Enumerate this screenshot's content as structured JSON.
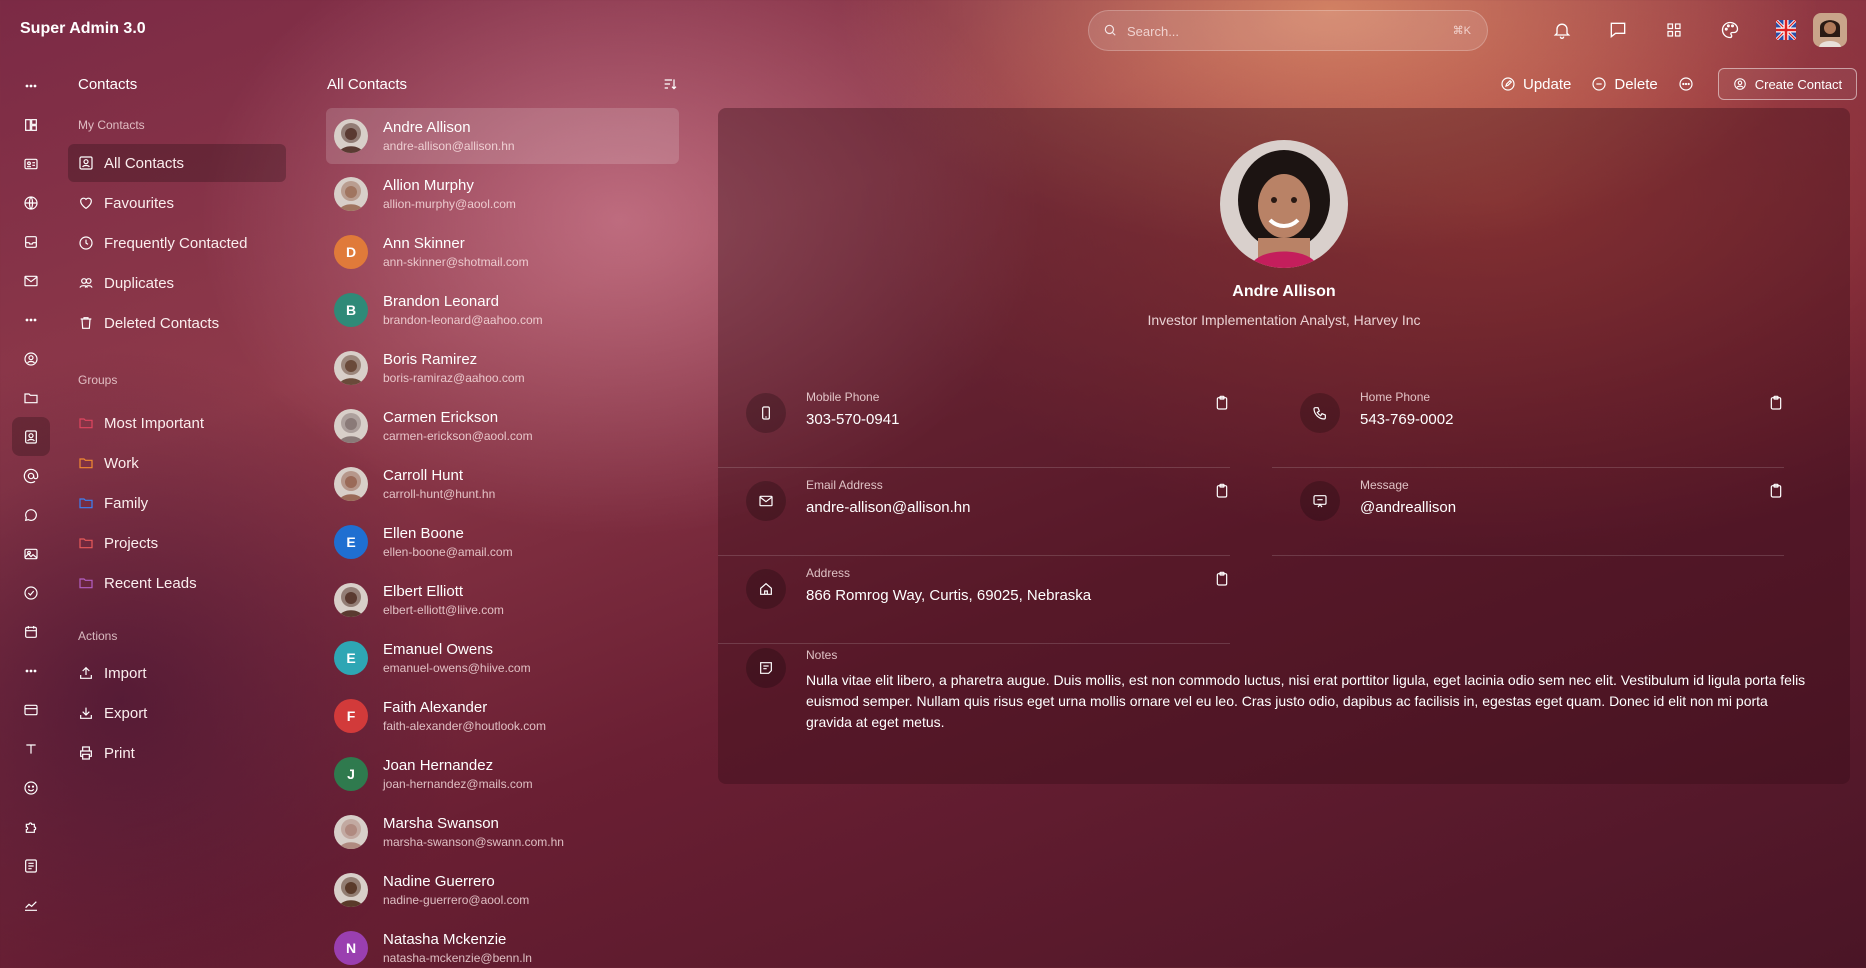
{
  "app": {
    "title": "Super Admin 3.0"
  },
  "search": {
    "placeholder": "Search...",
    "shortcut": "⌘K"
  },
  "top_icons": [
    "bell-icon",
    "chat-icon",
    "apps-grid-icon",
    "palette-icon",
    "uk-flag-icon"
  ],
  "rail_icons": [
    "more-dots-icon",
    "dashboard-icon",
    "id-card-icon",
    "globe-icon",
    "inbox-icon",
    "mail-icon",
    "more-dots-icon",
    "user-circle-icon",
    "folder-icon",
    "contacts-icon",
    "at-sign-icon",
    "chat-bubble-icon",
    "image-icon",
    "check-circle-icon",
    "calendar-icon",
    "more-dots-icon",
    "card-icon",
    "text-icon",
    "smile-icon",
    "puzzle-icon",
    "form-icon",
    "chart-line-icon"
  ],
  "sidebar": {
    "title": "Contacts",
    "my_contacts_label": "My Contacts",
    "my_contacts": [
      {
        "label": "All Contacts",
        "icon": "contact-card-icon"
      },
      {
        "label": "Favourites",
        "icon": "heart-icon"
      },
      {
        "label": "Frequently Contacted",
        "icon": "clock-icon"
      },
      {
        "label": "Duplicates",
        "icon": "users-icon"
      },
      {
        "label": "Deleted Contacts",
        "icon": "trash-icon"
      }
    ],
    "groups_label": "Groups",
    "groups": [
      {
        "label": "Most Important",
        "color": "#e0465f"
      },
      {
        "label": "Work",
        "color": "#f28b30"
      },
      {
        "label": "Family",
        "color": "#3b82f6"
      },
      {
        "label": "Projects",
        "color": "#e85a5a"
      },
      {
        "label": "Recent Leads",
        "color": "#b45fc4"
      }
    ],
    "actions_label": "Actions",
    "actions": [
      {
        "label": "Import",
        "icon": "upload-icon"
      },
      {
        "label": "Export",
        "icon": "download-icon"
      },
      {
        "label": "Print",
        "icon": "printer-icon"
      }
    ]
  },
  "contacts": {
    "title": "All Contacts",
    "items": [
      {
        "name": "Andre Allison",
        "email": "andre-allison@allison.hn",
        "avatar": "photo",
        "tone": "#5a3a32"
      },
      {
        "name": "Allion Murphy",
        "email": "allion-murphy@aool.com",
        "avatar": "photo",
        "tone": "#a07560"
      },
      {
        "name": "Ann Skinner",
        "email": "ann-skinner@shotmail.com",
        "avatar": "D",
        "tone": "#e07a3a"
      },
      {
        "name": "Brandon Leonard",
        "email": "brandon-leonard@aahoo.com",
        "avatar": "B",
        "tone": "#2f8a78"
      },
      {
        "name": "Boris Ramirez",
        "email": "boris-ramiraz@aahoo.com",
        "avatar": "photo",
        "tone": "#6a4a3a"
      },
      {
        "name": "Carmen Erickson",
        "email": "carmen-erickson@aool.com",
        "avatar": "photo",
        "tone": "#8a7a78"
      },
      {
        "name": "Carroll Hunt",
        "email": "carroll-hunt@hunt.hn",
        "avatar": "photo",
        "tone": "#9a6a58"
      },
      {
        "name": "Ellen Boone",
        "email": "ellen-boone@amail.com",
        "avatar": "E",
        "tone": "#1f6fd1"
      },
      {
        "name": "Elbert Elliott",
        "email": "elbert-elliott@liive.com",
        "avatar": "photo",
        "tone": "#5a3a30"
      },
      {
        "name": "Emanuel Owens",
        "email": "emanuel-owens@hiive.com",
        "avatar": "E",
        "tone": "#2ea6b4"
      },
      {
        "name": "Faith Alexander",
        "email": "faith-alexander@houtlook.com",
        "avatar": "F",
        "tone": "#d23a3a"
      },
      {
        "name": "Joan Hernandez",
        "email": "joan-hernandez@mails.com",
        "avatar": "J",
        "tone": "#2f7a4e"
      },
      {
        "name": "Marsha Swanson",
        "email": "marsha-swanson@swann.com.hn",
        "avatar": "photo",
        "tone": "#b08a80"
      },
      {
        "name": "Nadine Guerrero",
        "email": "nadine-guerrero@aool.com",
        "avatar": "photo",
        "tone": "#5a3a2a"
      },
      {
        "name": "Natasha Mckenzie",
        "email": "natasha-mckenzie@benn.ln",
        "avatar": "N",
        "tone": "#9a3fb0"
      }
    ]
  },
  "toolbar": {
    "update": "Update",
    "delete": "Delete",
    "create": "Create Contact"
  },
  "detail": {
    "name": "Andre Allison",
    "role": "Investor Implementation Analyst, Harvey Inc",
    "mobile_label": "Mobile Phone",
    "mobile": "303-570-0941",
    "home_label": "Home Phone",
    "home": "543-769-0002",
    "email_label": "Email Address",
    "email": "andre-allison@allison.hn",
    "message_label": "Message",
    "message": "@andreallison",
    "address_label": "Address",
    "address": "866 Romrog Way, Curtis, 69025, Nebraska",
    "notes_label": "Notes",
    "notes": "Nulla vitae elit libero, a pharetra augue. Duis mollis, est non commodo luctus, nisi erat porttitor ligula, eget lacinia odio sem nec elit. Vestibulum id ligula porta felis euismod semper. Nullam quis risus eget urna mollis ornare vel eu leo. Cras justo odio, dapibus ac facilisis in, egestas eget quam. Donec id elit non mi porta gravida at eget metus."
  }
}
